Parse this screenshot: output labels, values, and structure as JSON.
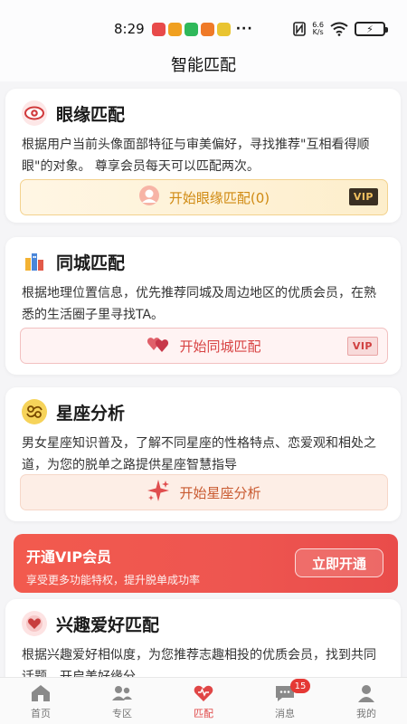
{
  "status": {
    "time": "8:29",
    "dots": "···",
    "speed_value": "6.6",
    "speed_unit": "K/s",
    "battery_icon": "battery-charging-icon"
  },
  "header": {
    "title": "智能匹配"
  },
  "cards": [
    {
      "title": "眼缘匹配",
      "desc": "根据用户当前头像面部特征与审美偏好，寻找推荐\"互相看得顺眼\"的对象。 尊享会员每天可以匹配两次。",
      "button_label": "开始眼缘匹配(0)",
      "vip": "VIP"
    },
    {
      "title": "同城匹配",
      "desc": "根据地理位置信息，优先推荐同城及周边地区的优质会员，在熟悉的生活圈子里寻找TA。",
      "button_label": "开始同城匹配",
      "vip": "VIP"
    },
    {
      "title": "星座分析",
      "desc": "男女星座知识普及，了解不同星座的性格特点、恋爱观和相处之道，为您的脱单之路提供星座智慧指导",
      "button_label": "开始星座分析"
    },
    {
      "title": "兴趣爱好匹配",
      "desc": "根据兴趣爱好相似度，为您推荐志趣相投的优质会员，找到共同话题，开启美好缘分。"
    }
  ],
  "vip_banner": {
    "title": "开通VIP会员",
    "subtitle": "享受更多功能特权，提升脱单成功率",
    "button": "立即开通"
  },
  "tabbar": {
    "items": [
      {
        "label": "首页",
        "icon": "home-icon"
      },
      {
        "label": "专区",
        "icon": "people-icon"
      },
      {
        "label": "匹配",
        "icon": "heart-icon"
      },
      {
        "label": "消息",
        "icon": "chat-icon",
        "badge": "15"
      },
      {
        "label": "我的",
        "icon": "user-icon"
      }
    ],
    "active": "匹配"
  },
  "colors": {
    "accent": "#e04646",
    "gold_text": "#d08a12",
    "banner": "#f0534d"
  }
}
